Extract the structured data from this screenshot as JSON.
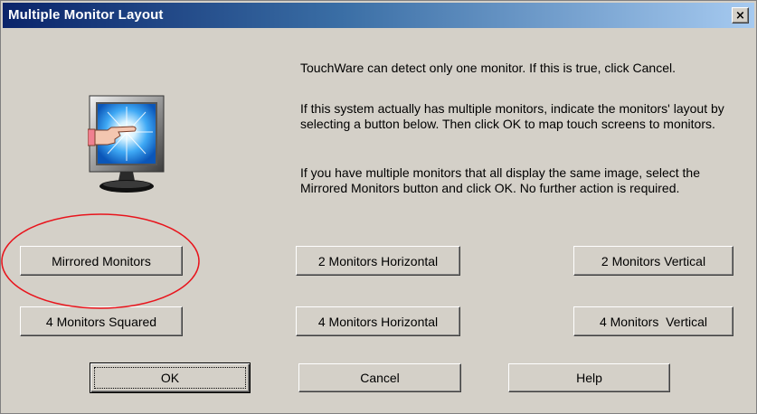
{
  "window": {
    "title": "Multiple Monitor Layout",
    "close_label": "×"
  },
  "graphic": {
    "icon": "monitor-touch-icon"
  },
  "description": {
    "para1": "TouchWare can detect only one monitor. If this is true, click Cancel.",
    "para2": "If this system actually has multiple monitors, indicate the monitors' layout by selecting a button below. Then click OK to map touch screens to monitors.",
    "para3": "If you have multiple monitors that all display the same image, select the Mirrored Monitors button and click OK. No further action is required."
  },
  "layout_buttons": {
    "mirrored": "Mirrored Monitors",
    "two_horizontal": "2 Monitors Horizontal",
    "two_vertical": "2 Monitors Vertical",
    "four_squared": "4 Monitors Squared",
    "four_horizontal": "4 Monitors Horizontal",
    "four_vertical": "4 Monitors  Vertical"
  },
  "dialog_buttons": {
    "ok": "OK",
    "cancel": "Cancel",
    "help": "Help"
  },
  "colors": {
    "dialog_bg": "#d4d0c8",
    "title_start": "#0a246a",
    "title_end": "#a6caf0",
    "annotation": "#e8141c"
  }
}
